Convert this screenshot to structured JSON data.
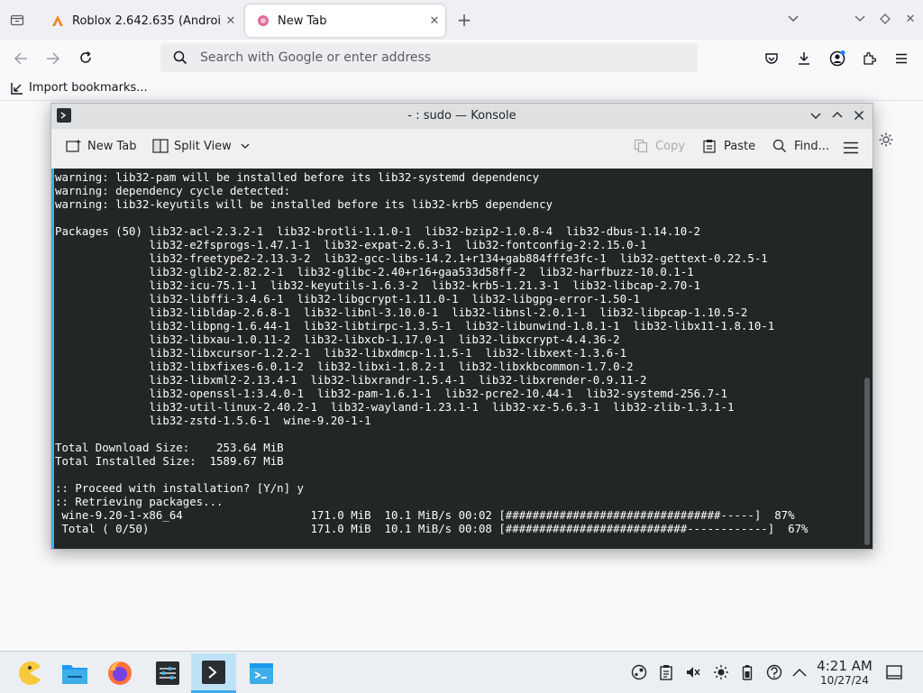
{
  "browser": {
    "tabs": [
      {
        "title": "Roblox 2.642.635 (Android",
        "active": false
      },
      {
        "title": "New Tab",
        "active": true
      }
    ],
    "urlbar": {
      "placeholder": "Search with Google or enter address"
    },
    "bookmarks": {
      "import_label": "Import bookmarks..."
    }
  },
  "konsole": {
    "title": "- : sudo — Konsole",
    "toolbar": {
      "new_tab": "New Tab",
      "split_view": "Split View",
      "copy": "Copy",
      "paste": "Paste",
      "find": "Find..."
    },
    "terminal_lines": [
      "warning: lib32-pam will be installed before its lib32-systemd dependency",
      "warning: dependency cycle detected:",
      "warning: lib32-keyutils will be installed before its lib32-krb5 dependency",
      "",
      "Packages (50) lib32-acl-2.3.2-1  lib32-brotli-1.1.0-1  lib32-bzip2-1.0.8-4  lib32-dbus-1.14.10-2",
      "              lib32-e2fsprogs-1.47.1-1  lib32-expat-2.6.3-1  lib32-fontconfig-2:2.15.0-1",
      "              lib32-freetype2-2.13.3-2  lib32-gcc-libs-14.2.1+r134+gab884fffe3fc-1  lib32-gettext-0.22.5-1",
      "              lib32-glib2-2.82.2-1  lib32-glibc-2.40+r16+gaa533d58ff-2  lib32-harfbuzz-10.0.1-1",
      "              lib32-icu-75.1-1  lib32-keyutils-1.6.3-2  lib32-krb5-1.21.3-1  lib32-libcap-2.70-1",
      "              lib32-libffi-3.4.6-1  lib32-libgcrypt-1.11.0-1  lib32-libgpg-error-1.50-1",
      "              lib32-libldap-2.6.8-1  lib32-libnl-3.10.0-1  lib32-libnsl-2.0.1-1  lib32-libpcap-1.10.5-2",
      "              lib32-libpng-1.6.44-1  lib32-libtirpc-1.3.5-1  lib32-libunwind-1.8.1-1  lib32-libx11-1.8.10-1",
      "              lib32-libxau-1.0.11-2  lib32-libxcb-1.17.0-1  lib32-libxcrypt-4.4.36-2",
      "              lib32-libxcursor-1.2.2-1  lib32-libxdmcp-1.1.5-1  lib32-libxext-1.3.6-1",
      "              lib32-libxfixes-6.0.1-2  lib32-libxi-1.8.2-1  lib32-libxkbcommon-1.7.0-2",
      "              lib32-libxml2-2.13.4-1  lib32-libxrandr-1.5.4-1  lib32-libxrender-0.9.11-2",
      "              lib32-openssl-1:3.4.0-1  lib32-pam-1.6.1-1  lib32-pcre2-10.44-1  lib32-systemd-256.7-1",
      "              lib32-util-linux-2.40.2-1  lib32-wayland-1.23.1-1  lib32-xz-5.6.3-1  lib32-zlib-1.3.1-1",
      "              lib32-zstd-1.5.6-1  wine-9.20-1-1",
      "",
      "Total Download Size:    253.64 MiB",
      "Total Installed Size:  1589.67 MiB",
      "",
      ":: Proceed with installation? [Y/n] y",
      ":: Retrieving packages...",
      " wine-9.20-1-x86_64                   171.0 MiB  10.1 MiB/s 00:02 [################################-----]  87%",
      " Total ( 0/50)                        171.0 MiB  10.1 MiB/s 00:08 [###########################------------]  67%"
    ]
  },
  "taskbar": {
    "time": "4:21 AM",
    "date": "10/27/24"
  },
  "colors": {
    "accent": "#3daee9",
    "terminal_bg": "#232627",
    "terminal_fg": "#fcfcfc"
  }
}
